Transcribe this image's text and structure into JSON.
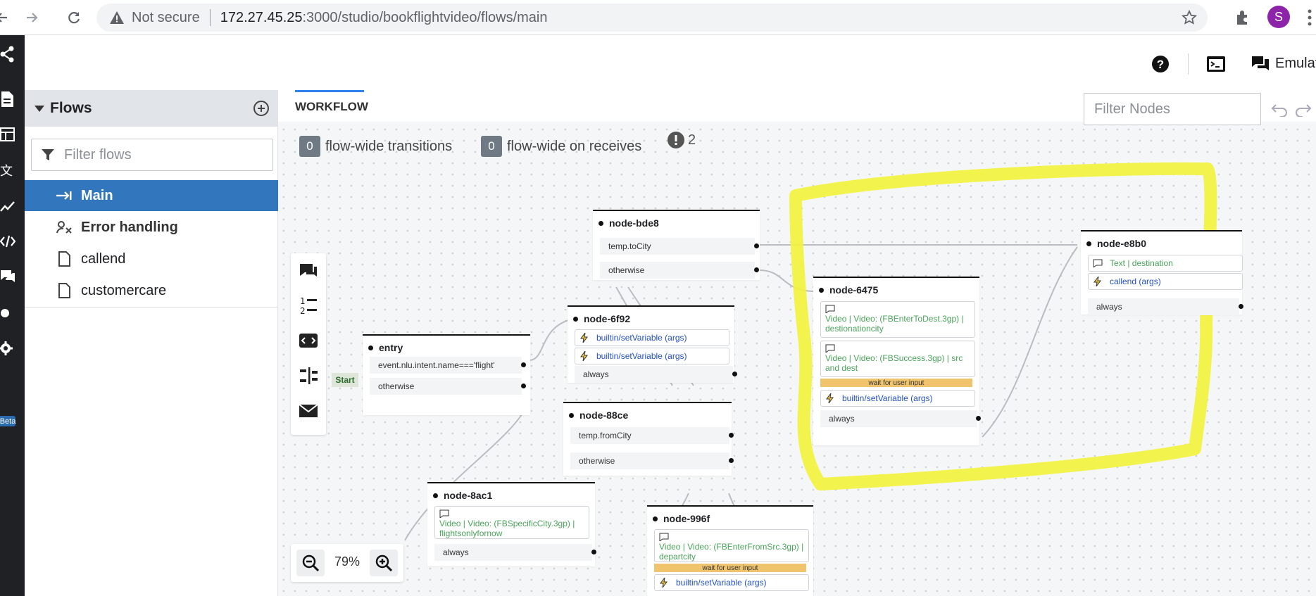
{
  "browser": {
    "not_secure": "Not secure",
    "url_host": "172.27.45.25",
    "url_path": ":3000/studio/bookflightvideo/flows/main",
    "avatar_letter": "S"
  },
  "header": {
    "emulator_label": "Emulator"
  },
  "rail": {
    "beta_label": "Beta"
  },
  "sidebar": {
    "title": "Flows",
    "filter_placeholder": "Filter flows",
    "items": [
      {
        "label": "Main",
        "icon": "flow-entry-icon",
        "active": true
      },
      {
        "label": "Error handling",
        "icon": "error-handling-icon"
      },
      {
        "label": "callend",
        "icon": "file-icon"
      },
      {
        "label": "customercare",
        "icon": "file-icon"
      }
    ]
  },
  "workflow": {
    "tab_label": "WORKFLOW",
    "filter_nodes_placeholder": "Filter Nodes",
    "transitions_count": "0",
    "transitions_label": "flow-wide transitions",
    "receives_count": "0",
    "receives_label": "flow-wide on receives",
    "warning_count": "2",
    "zoom_level": "79%",
    "start_label": "Start"
  },
  "nodes": {
    "entry": {
      "title": "entry",
      "rows": [
        "event.nlu.intent.name==='flight'",
        "otherwise"
      ]
    },
    "bde8": {
      "title": "node-bde8",
      "rows": [
        "temp.toCity",
        "otherwise"
      ]
    },
    "n6f92": {
      "title": "node-6f92",
      "actions": [
        "builtin/setVariable (args)",
        "builtin/setVariable (args)"
      ],
      "rows": [
        "always"
      ]
    },
    "n88ce": {
      "title": "node-88ce",
      "rows": [
        "temp.fromCity",
        "otherwise"
      ]
    },
    "n8ac1": {
      "title": "node-8ac1",
      "say": "Video | Video: (FBSpecificCity.3gp) | flightsonlyfornow",
      "rows": [
        "always"
      ]
    },
    "n996f": {
      "title": "node-996f",
      "say": "Video | Video: (FBEnterFromSrc.3gp) | departcity",
      "wait": "wait for user input",
      "actions": [
        "builtin/setVariable (args)"
      ]
    },
    "n6475": {
      "title": "node-6475",
      "say1": "Video | Video: (FBEnterToDest.3gp) | destionationcity",
      "say2": "Video | Video: (FBSuccess.3gp) | src and dest",
      "wait": "wait for user input",
      "actions": [
        "builtin/setVariable (args)"
      ],
      "rows": [
        "always"
      ]
    },
    "e8b0": {
      "title": "node-e8b0",
      "say": "Text | destination",
      "actions": [
        "callend (args)"
      ],
      "rows": [
        "always"
      ]
    }
  },
  "colors": {
    "accent": "#3277bd",
    "highlight": "#f3f33a",
    "wait_bar": "#f0c36d",
    "say_text": "#4aa35a",
    "action_text": "#2350c4"
  }
}
